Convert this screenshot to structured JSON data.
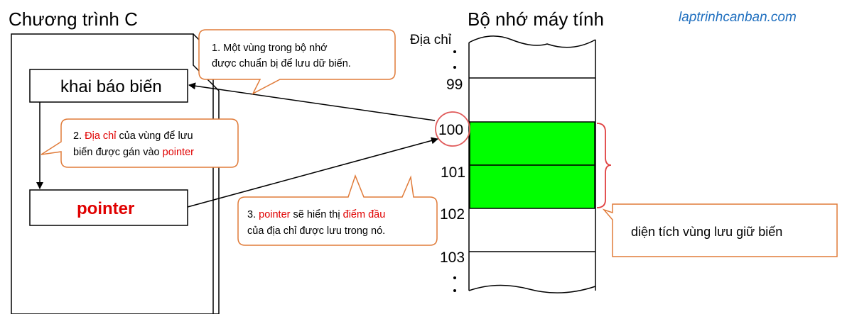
{
  "program": {
    "title": "Chương trình C",
    "declare_box": "khai báo biến",
    "pointer_box": "pointer"
  },
  "memory": {
    "title": "Bộ nhớ máy tính",
    "address_header": "Địa chỉ",
    "addresses": [
      "99",
      "100",
      "101",
      "102",
      "103"
    ],
    "highlighted_address": "100"
  },
  "watermark": "laptrinhcanban.com",
  "callouts": {
    "c1": {
      "line1": "1. Một vùng trong bộ nhớ",
      "line2": "được chuẩn bị để lưu dữ biến."
    },
    "c2": {
      "l1_prefix": "2. ",
      "l1_red": "Địa chỉ",
      "l1_suffix": " của vùng để lưu",
      "l2_prefix": "biến được gán vào ",
      "l2_red": "pointer"
    },
    "c3": {
      "l1_prefix": "3. ",
      "l1_red1": "pointer",
      "l1_mid": " sẽ hiển thị ",
      "l1_red2": "điểm đầu",
      "l2": "của địa chỉ được lưu trong nó."
    },
    "area_label": "diện tích vùng lưu giữ biến"
  },
  "colors": {
    "accent_red": "#e00000",
    "callout_border": "#e07b39",
    "highlight_green": "#00ff00",
    "circle_red": "#e05a5a",
    "brace_red": "#e04040",
    "link_blue": "#1f6fbf"
  }
}
